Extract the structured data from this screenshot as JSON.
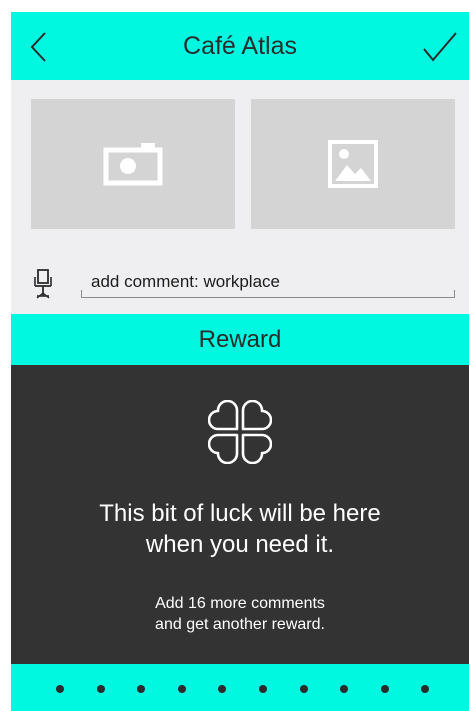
{
  "header": {
    "title": "Café Atlas",
    "back_icon": "back-chevron-icon",
    "confirm_icon": "checkmark-icon"
  },
  "media": {
    "camera_icon": "camera-icon",
    "gallery_icon": "image-icon"
  },
  "comment": {
    "icon": "chair-icon",
    "value": "add comment: workplace"
  },
  "reward": {
    "title": "Reward",
    "icon": "clover-icon",
    "message_line1": "This bit of luck will be here",
    "message_line2": "when you need it.",
    "hint_line1": "Add 16 more comments",
    "hint_line2": "and get another reward."
  },
  "pager": {
    "dot_count": 10
  },
  "colors": {
    "accent": "#00f8e1",
    "panel": "#333333",
    "background": "#efeff1",
    "tile": "#d4d4d4"
  }
}
